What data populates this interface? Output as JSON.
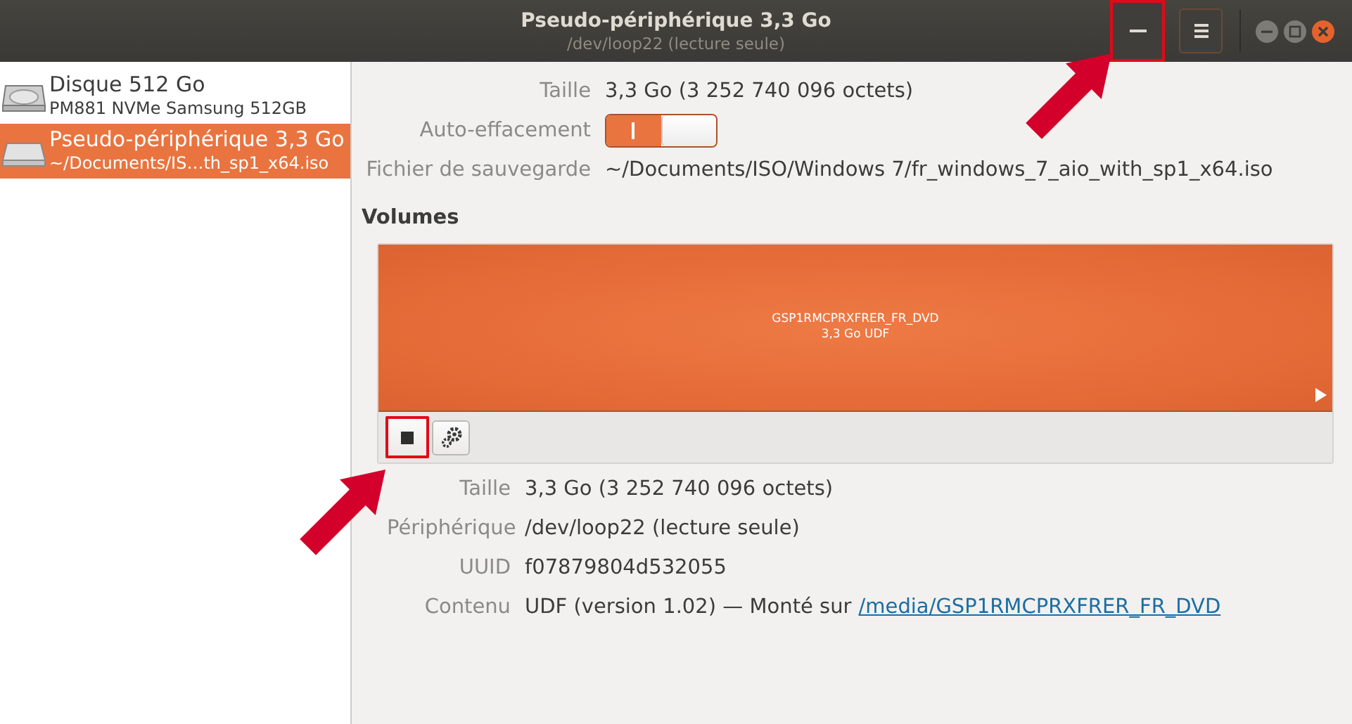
{
  "window": {
    "title": "Pseudo-périphérique 3,3 Go",
    "subtitle": "/dev/loop22 (lecture seule)",
    "buttons": [
      {
        "kind": "minimize",
        "highlighted": true
      },
      {
        "kind": "menu",
        "highlighted": false
      }
    ]
  },
  "sidebar": {
    "items": [
      {
        "kind": "disk",
        "title": "Disque 512 Go",
        "subtitle": "PM881 NVMe Samsung 512GB",
        "selected": false
      },
      {
        "kind": "loop",
        "title": "Pseudo-périphérique 3,3 Go",
        "subtitle": "~/Documents/IS…th_sp1_x64.iso",
        "selected": true
      }
    ]
  },
  "drive": {
    "rows": [
      {
        "kind": "text",
        "label": "Taille",
        "value": "3,3 Go (3 252 740 096 octets)"
      },
      {
        "kind": "switch",
        "label": "Auto-effacement",
        "on": true
      },
      {
        "kind": "text",
        "label": "Fichier de sauvegarde",
        "value": "~/Documents/ISO/Windows 7/fr_windows_7_aio_with_sp1_x64.iso"
      }
    ]
  },
  "volumes": {
    "heading": "Volumes",
    "partition": {
      "name": "GSP1RMCPRXFRER_FR_DVD",
      "detail": "3,3 Go UDF"
    },
    "tools": [
      {
        "kind": "stop",
        "highlighted": true
      },
      {
        "kind": "settings",
        "highlighted": false
      }
    ]
  },
  "volume_details": [
    {
      "label": "Taille",
      "value": "3,3 Go (3 252 740 096 octets)"
    },
    {
      "label": "Périphérique",
      "value": "/dev/loop22 (lecture seule)"
    },
    {
      "label": "UUID",
      "value": "f07879804d532055"
    },
    {
      "label": "Contenu",
      "value": "UDF (version 1.02) — Monté sur",
      "link": "/media/GSP1RMCPRXFRER_FR_DVD"
    }
  ]
}
